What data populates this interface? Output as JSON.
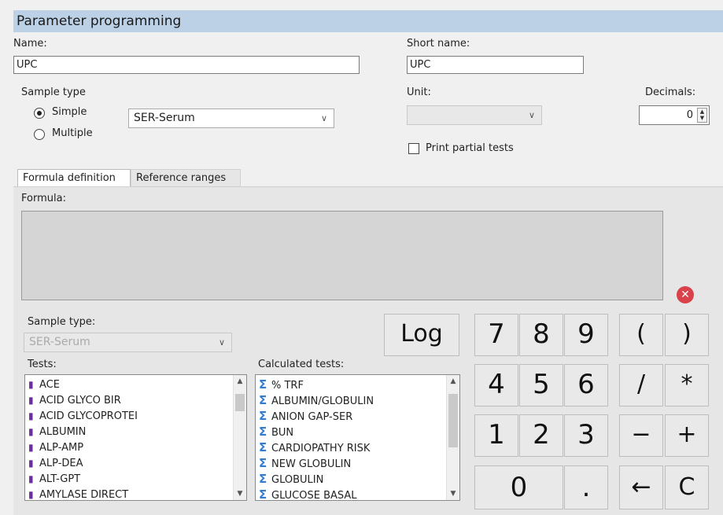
{
  "title": "Parameter programming",
  "name_label": "Name:",
  "name_value": "UPC",
  "short_name_label": "Short name:",
  "short_name_value": "UPC",
  "sample_type_label": "Sample type",
  "simple_label": "Simple",
  "multiple_label": "Multiple",
  "sample_type_selected": "SER-Serum",
  "unit_label": "Unit:",
  "unit_value": "",
  "decimals_label": "Decimals:",
  "decimals_value": "0",
  "print_partial_label": "Print partial tests",
  "tabs": [
    {
      "label": "Formula definition"
    },
    {
      "label": "Reference ranges"
    }
  ],
  "formula_label": "Formula:",
  "formula_value": "",
  "lower_sample_type_label": "Sample type:",
  "lower_sample_type_value": "SER-Serum",
  "tests_label": "Tests:",
  "tests": [
    "ACE",
    "ACID GLYCO BIR",
    "ACID GLYCOPROTEI",
    "ALBUMIN",
    "ALP-AMP",
    "ALP-DEA",
    "ALT-GPT",
    "AMYLASE DIRECT"
  ],
  "calculated_label": "Calculated tests:",
  "calculated_tests": [
    "% TRF",
    "ALBUMIN/GLOBULIN",
    "ANION GAP-SER",
    "BUN",
    "CARDIOPATHY RISK",
    "NEW GLOBULIN",
    "GLOBULIN",
    "GLUCOSE BASAL"
  ],
  "keypad": {
    "log": "Log",
    "k7": "7",
    "k8": "8",
    "k9": "9",
    "k4": "4",
    "k5": "5",
    "k6": "6",
    "k1": "1",
    "k2": "2",
    "k3": "3",
    "k0": "0",
    "dot": ".",
    "lparen": "(",
    "rparen": ")",
    "slash": "/",
    "star": "*",
    "minus": "−",
    "plus": "+",
    "back": "←",
    "clear": "C"
  },
  "icons": {
    "clear_formula": "close-circle-icon",
    "test_item": "test-tube-icon",
    "calculated_item": "sigma-icon"
  },
  "colors": {
    "title_bar": "#bcd0e6",
    "clear_icon": "#d9424b",
    "test_icon": "#6a2f9c",
    "sigma_icon": "#2f7bd6"
  }
}
